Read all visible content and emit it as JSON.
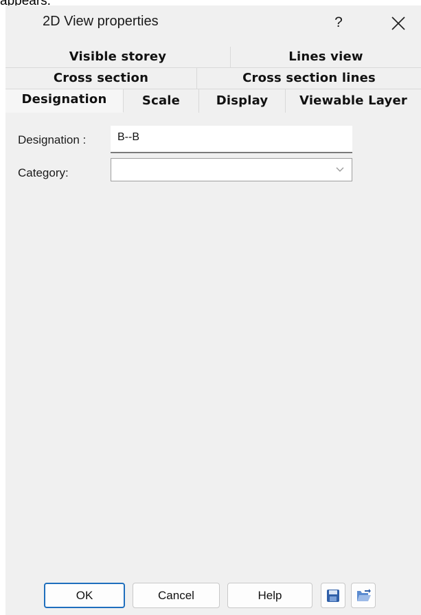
{
  "page_fragment": "appears.",
  "dialog": {
    "title": "2D View properties",
    "help_label": "?"
  },
  "tabs": {
    "row1": [
      "Visible storey",
      "Lines view"
    ],
    "row2": [
      "Cross section",
      "Cross section lines"
    ],
    "row3": [
      "Designation",
      "Scale",
      "Display",
      "Viewable Layer"
    ],
    "active": "Designation"
  },
  "form": {
    "designation_label": "Designation :",
    "designation_value": "B--B",
    "category_label": "Category:",
    "category_value": ""
  },
  "buttons": {
    "ok": "OK",
    "cancel": "Cancel",
    "help": "Help"
  },
  "icons": {
    "save": "save-floppy-icon",
    "open": "open-folder-icon",
    "close": "close-x-icon",
    "chevron": "chevron-down-icon"
  },
  "colors": {
    "accent_border": "#1e6ebd",
    "dialog_bg": "#f0f0f0"
  }
}
